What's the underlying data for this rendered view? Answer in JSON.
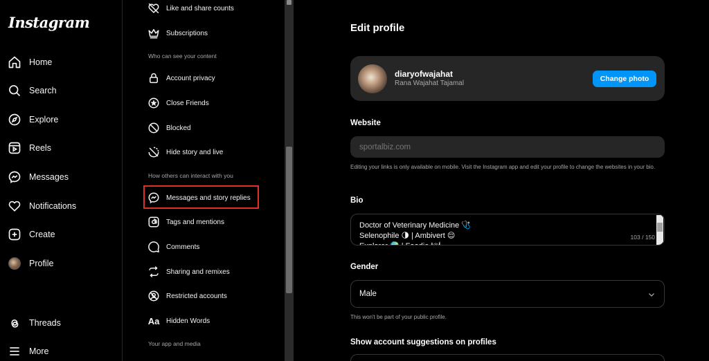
{
  "app": {
    "logo": "Instagram"
  },
  "nav": {
    "items": [
      {
        "label": "Home",
        "icon": "home-icon"
      },
      {
        "label": "Search",
        "icon": "search-icon"
      },
      {
        "label": "Explore",
        "icon": "compass-icon"
      },
      {
        "label": "Reels",
        "icon": "reels-icon"
      },
      {
        "label": "Messages",
        "icon": "messenger-icon"
      },
      {
        "label": "Notifications",
        "icon": "heart-icon"
      },
      {
        "label": "Create",
        "icon": "plus-square-icon"
      },
      {
        "label": "Profile",
        "icon": "avatar"
      },
      {
        "label": "Threads",
        "icon": "threads-icon"
      },
      {
        "label": "More",
        "icon": "menu-icon"
      }
    ]
  },
  "settings": {
    "items": [
      {
        "label": "Like and share counts",
        "icon": "heart-off-icon"
      },
      {
        "label": "Subscriptions",
        "icon": "crown-icon"
      },
      {
        "label": "Account privacy",
        "icon": "lock-icon"
      },
      {
        "label": "Close Friends",
        "icon": "star-circle-icon"
      },
      {
        "label": "Blocked",
        "icon": "block-icon"
      },
      {
        "label": "Hide story and live",
        "icon": "story-off-icon"
      },
      {
        "label": "Messages and story replies",
        "icon": "messenger-icon"
      },
      {
        "label": "Tags and mentions",
        "icon": "at-icon"
      },
      {
        "label": "Comments",
        "icon": "comment-icon"
      },
      {
        "label": "Sharing and remixes",
        "icon": "remix-icon"
      },
      {
        "label": "Restricted accounts",
        "icon": "restricted-icon"
      },
      {
        "label": "Hidden Words",
        "icon": "text-aa-icon"
      }
    ],
    "headings": {
      "who_can_see": "Who can see your content",
      "how_others": "How others can interact with you",
      "app_media": "Your app and media"
    },
    "hidden_words_glyph": "Aa"
  },
  "main": {
    "title": "Edit profile",
    "profile": {
      "username": "diaryofwajahat",
      "full_name": "Rana Wajahat Tajamal",
      "change_photo_label": "Change photo"
    },
    "website": {
      "label": "Website",
      "placeholder": "sportalbiz.com",
      "hint": "Editing your links is only available on mobile. Visit the Instagram app and edit your profile to change the websites in your bio."
    },
    "bio": {
      "label": "Bio",
      "text": "Doctor of Veterinary Medicine 🩺\nSelenophile 🌗 | Ambivert 😌\nExplorer 🌍 | Foodie 🍽",
      "count": "103 / 150"
    },
    "gender": {
      "label": "Gender",
      "value": "Male",
      "hint": "This won't be part of your public profile."
    },
    "suggestions": {
      "label": "Show account suggestions on profiles"
    }
  },
  "colors": {
    "accent": "#0095f6",
    "highlight": "#e0302c",
    "card": "#262626"
  }
}
